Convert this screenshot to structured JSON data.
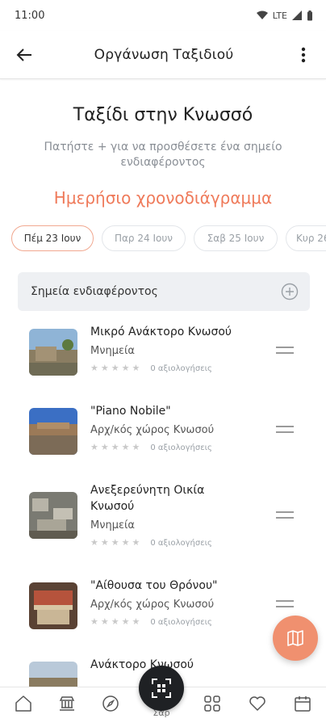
{
  "status_bar": {
    "time": "11:00",
    "network": "LTE"
  },
  "app_bar": {
    "title": "Οργάνωση Ταξιδιού",
    "back_icon": "arrow-back-icon",
    "menu_icon": "more-vert-icon"
  },
  "trip": {
    "title": "Ταξίδι στην Κνωσσό",
    "hint": "Πατήστε + για να προσθέσετε ένα σημείο ενδιαφέροντος",
    "schedule_title": "Ημερήσιο χρονοδιάγραμμα"
  },
  "days": [
    {
      "label": "Πέμ 23 Ιουν",
      "selected": true
    },
    {
      "label": "Παρ 24 Ιουν",
      "selected": false
    },
    {
      "label": "Σαβ 25 Ιουν",
      "selected": false
    },
    {
      "label": "Κυρ 26",
      "selected": false
    }
  ],
  "poi_header": {
    "label": "Σημεία ενδιαφέροντος",
    "add_icon": "add-circle-icon"
  },
  "pois": [
    {
      "name": "Μικρό Ανάκτορο Κνωσού",
      "category": "Μνημεία",
      "rating_text": "0 αξιολογήσεις",
      "stars": 0
    },
    {
      "name": "\"Piano Nobile\"",
      "category": "Αρχ/κός χώρος Κνωσού",
      "rating_text": "0 αξιολογήσεις",
      "stars": 0
    },
    {
      "name_line1": "Ανεξερεύνητη Οικία",
      "name_line2": "Κνωσού",
      "category": "Μνημεία",
      "rating_text": "0 αξιολογήσεις",
      "stars": 0
    },
    {
      "name": "\"Αίθουσα του Θρόνου\"",
      "category": "Αρχ/κός χώρος Κνωσού",
      "rating_text": "0 αξιολογήσεις",
      "stars": 0
    },
    {
      "name": "Ανάκτορο Κνωσού",
      "category": "",
      "rating_text": "",
      "stars": 0
    }
  ],
  "fab": {
    "icon": "map-icon"
  },
  "bottom_nav": {
    "items": [
      "home-icon",
      "museum-icon",
      "compass-icon",
      "scan-icon",
      "grid-icon",
      "heart-icon",
      "calendar-icon"
    ],
    "center_label": "Σαρ"
  },
  "colors": {
    "accent": "#ef7a5a",
    "fab": "#f0906f",
    "chip_border_active": "#f1a890",
    "header_bg": "#eef0f3"
  }
}
